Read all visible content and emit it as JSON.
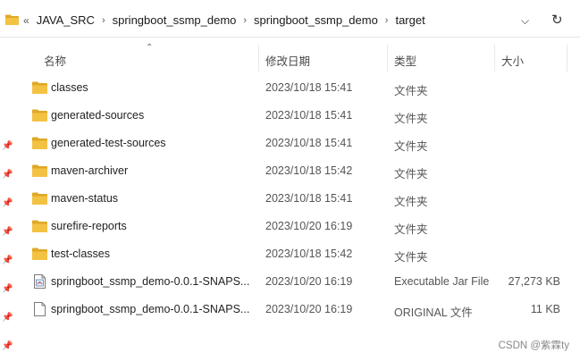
{
  "breadcrumb": {
    "overflow": "«",
    "segments": [
      "JAVA_SRC",
      "springboot_ssmp_demo",
      "springboot_ssmp_demo",
      "target"
    ]
  },
  "columns": {
    "name": "名称",
    "date": "修改日期",
    "type": "类型",
    "size": "大小"
  },
  "files": [
    {
      "name": "classes",
      "date": "2023/10/18 15:41",
      "type": "文件夹",
      "size": "",
      "icon": "folder-icon"
    },
    {
      "name": "generated-sources",
      "date": "2023/10/18 15:41",
      "type": "文件夹",
      "size": "",
      "icon": "folder-icon"
    },
    {
      "name": "generated-test-sources",
      "date": "2023/10/18 15:41",
      "type": "文件夹",
      "size": "",
      "icon": "folder-icon"
    },
    {
      "name": "maven-archiver",
      "date": "2023/10/18 15:42",
      "type": "文件夹",
      "size": "",
      "icon": "folder-icon"
    },
    {
      "name": "maven-status",
      "date": "2023/10/18 15:41",
      "type": "文件夹",
      "size": "",
      "icon": "folder-icon"
    },
    {
      "name": "surefire-reports",
      "date": "2023/10/20 16:19",
      "type": "文件夹",
      "size": "",
      "icon": "folder-icon"
    },
    {
      "name": "test-classes",
      "date": "2023/10/18 15:42",
      "type": "文件夹",
      "size": "",
      "icon": "folder-icon"
    },
    {
      "name": "springboot_ssmp_demo-0.0.1-SNAPS...",
      "date": "2023/10/20 16:19",
      "type": "Executable Jar File",
      "size": "27,273 KB",
      "icon": "jar-file-icon"
    },
    {
      "name": "springboot_ssmp_demo-0.0.1-SNAPS...",
      "date": "2023/10/20 16:19",
      "type": "ORIGINAL 文件",
      "size": "11 KB",
      "icon": "blank-file-icon"
    }
  ],
  "watermark": "CSDN @紫霖ty",
  "colors": {
    "folder": "#F4C243",
    "folder_dark": "#E0A825"
  }
}
